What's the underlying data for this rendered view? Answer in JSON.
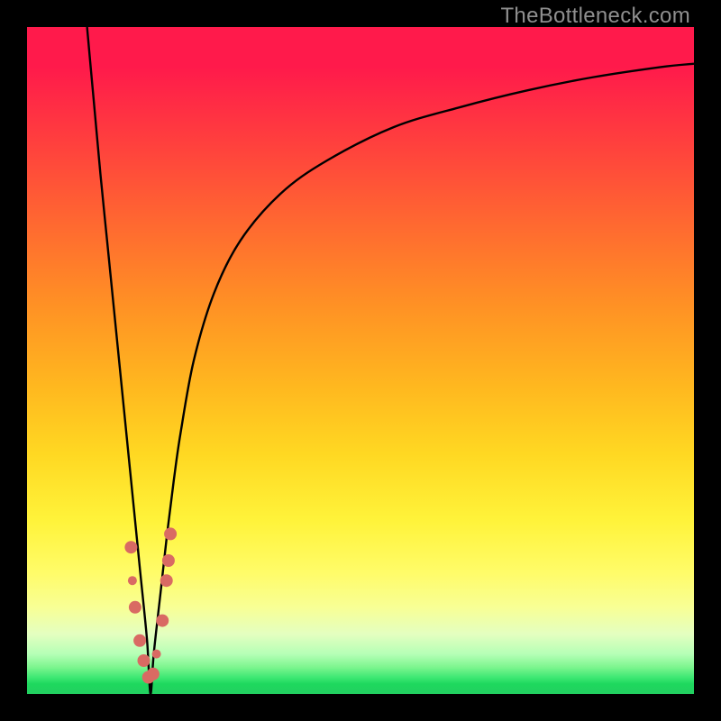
{
  "watermark": "TheBottleneck.com",
  "chart_data": {
    "type": "line",
    "title": "",
    "xlabel": "",
    "ylabel": "",
    "xlim": [
      0,
      100
    ],
    "ylim": [
      0,
      100
    ],
    "grid": false,
    "background_gradient": {
      "direction": "vertical",
      "stops": [
        {
          "pos": 0.0,
          "color": "#ff1a4b"
        },
        {
          "pos": 0.5,
          "color": "#ffb81f"
        },
        {
          "pos": 0.8,
          "color": "#fff33a"
        },
        {
          "pos": 0.95,
          "color": "#7cf58e"
        },
        {
          "pos": 1.0,
          "color": "#22d060"
        }
      ]
    },
    "optimum_x": 18.5,
    "series": [
      {
        "name": "bottleneck-curve",
        "color": "#000000",
        "x": [
          9.0,
          10.0,
          11.0,
          12.0,
          13.0,
          14.0,
          15.0,
          16.0,
          17.0,
          18.0,
          18.5,
          19.0,
          20.0,
          21.0,
          22.0,
          23.0,
          25.0,
          28.0,
          32.0,
          38.0,
          45.0,
          55.0,
          65.0,
          75.0,
          85.0,
          95.0,
          100.0
        ],
        "y": [
          100,
          89,
          78,
          68,
          58,
          48,
          38,
          28,
          18,
          8,
          0,
          6,
          15,
          24,
          32,
          39,
          50,
          60,
          68,
          75,
          80,
          85,
          88,
          90.5,
          92.5,
          94,
          94.5
        ]
      }
    ],
    "markers": {
      "name": "near-optimum-points",
      "color": "#d96a63",
      "radius_main": 7,
      "radius_small": 5,
      "points": [
        {
          "x": 15.6,
          "y": 22,
          "r": "main"
        },
        {
          "x": 15.8,
          "y": 17,
          "r": "small"
        },
        {
          "x": 16.2,
          "y": 13,
          "r": "main"
        },
        {
          "x": 16.9,
          "y": 8,
          "r": "main"
        },
        {
          "x": 17.5,
          "y": 5,
          "r": "main"
        },
        {
          "x": 18.2,
          "y": 2.5,
          "r": "main"
        },
        {
          "x": 18.9,
          "y": 3,
          "r": "main"
        },
        {
          "x": 19.4,
          "y": 6,
          "r": "small"
        },
        {
          "x": 20.3,
          "y": 11,
          "r": "main"
        },
        {
          "x": 20.9,
          "y": 17,
          "r": "main"
        },
        {
          "x": 21.2,
          "y": 20,
          "r": "main"
        },
        {
          "x": 21.5,
          "y": 24,
          "r": "main"
        }
      ]
    }
  }
}
